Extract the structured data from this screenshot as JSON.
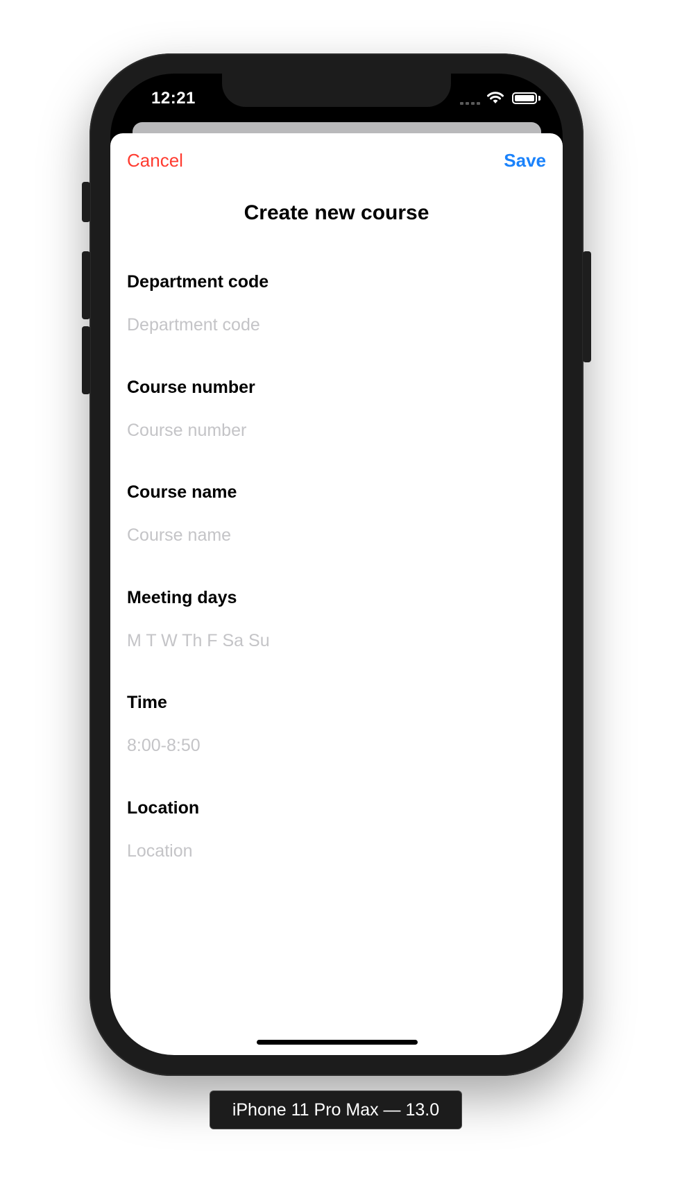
{
  "status_bar": {
    "time": "12:21",
    "icons": [
      "cellular-signal-icon",
      "wifi-icon",
      "battery-icon"
    ]
  },
  "sheet": {
    "cancel_label": "Cancel",
    "save_label": "Save",
    "title": "Create new course"
  },
  "form": {
    "fields": [
      {
        "label": "Department code",
        "placeholder": "Department code",
        "value": ""
      },
      {
        "label": "Course number",
        "placeholder": "Course number",
        "value": ""
      },
      {
        "label": "Course name",
        "placeholder": "Course name",
        "value": ""
      },
      {
        "label": "Meeting days",
        "placeholder": "M T W Th F Sa Su",
        "value": ""
      },
      {
        "label": "Time",
        "placeholder": "8:00-8:50",
        "value": ""
      },
      {
        "label": "Location",
        "placeholder": "Location",
        "value": ""
      }
    ]
  },
  "simulator": {
    "device_label": "iPhone 11 Pro Max — 13.0"
  },
  "colors": {
    "cancel": "#ff3b30",
    "save": "#1a82fb",
    "placeholder": "#c4c4c7",
    "device_frame": "#1c1c1c"
  }
}
